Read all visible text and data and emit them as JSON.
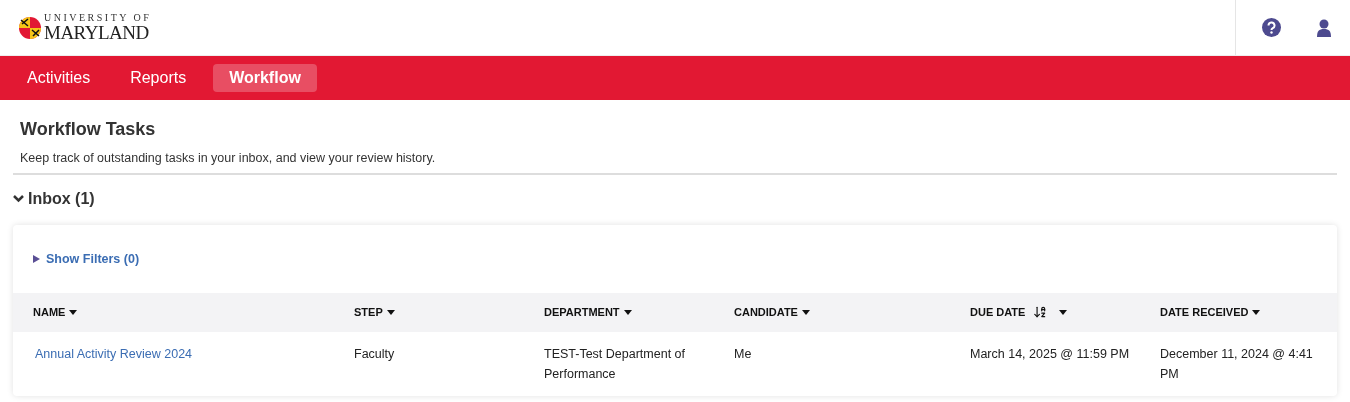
{
  "logo": {
    "line1": "UNIVERSITY OF",
    "line2": "MARYLAND"
  },
  "nav": [
    {
      "label": "Activities",
      "selected": false
    },
    {
      "label": "Reports",
      "selected": false
    },
    {
      "label": "Workflow",
      "selected": true
    }
  ],
  "page": {
    "title": "Workflow Tasks",
    "subtitle": "Keep track of outstanding tasks in your inbox, and view your review history."
  },
  "inbox": {
    "label": "Inbox (1)",
    "expanded": true,
    "filters": "Show Filters (0)",
    "columns": [
      {
        "label": "NAME",
        "sorted": false
      },
      {
        "label": "STEP",
        "sorted": false
      },
      {
        "label": "DEPARTMENT",
        "sorted": false
      },
      {
        "label": "CANDIDATE",
        "sorted": false
      },
      {
        "label": "DUE DATE",
        "sorted": true
      },
      {
        "label": "DATE RECEIVED",
        "sorted": false
      }
    ],
    "rows": [
      [
        "Annual Activity Review 2024",
        "Faculty",
        "TEST-Test Department of Performance",
        "Me",
        "March 14, 2025 @ 11:59 PM",
        "December 11, 2024 @ 4:41 PM"
      ]
    ]
  }
}
